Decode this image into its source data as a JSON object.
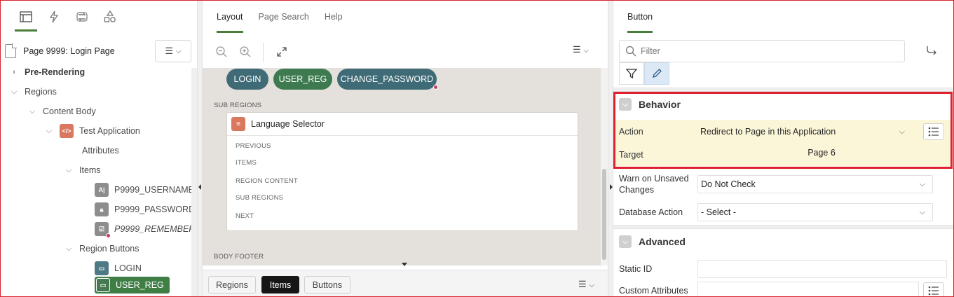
{
  "left_panel": {
    "tabs": [
      {
        "icon": "rendering-tree-icon",
        "active": true
      },
      {
        "icon": "dynamic-actions-icon",
        "active": false
      },
      {
        "icon": "processing-icon",
        "active": false
      },
      {
        "icon": "shared-components-icon",
        "active": false
      }
    ],
    "page_title": "Page 9999: Login Page",
    "tree": {
      "pre_rendering": "Pre-Rendering",
      "regions": "Regions",
      "content_body": "Content Body",
      "test_application": "Test Application",
      "attributes": "Attributes",
      "items": "Items",
      "item_username": "P9999_USERNAME",
      "item_password": "P9999_PASSWORD",
      "item_remember": "P9999_REMEMBER",
      "region_buttons": "Region Buttons",
      "btn_login": "LOGIN",
      "btn_user_reg": "USER_REG"
    }
  },
  "center_panel": {
    "tabs": [
      "Layout",
      "Page Search",
      "Help"
    ],
    "active_tab": "Layout",
    "canvas": {
      "buttons": [
        "LOGIN",
        "USER_REG",
        "CHANGE_PASSWORD"
      ],
      "sub_regions_label": "SUB REGIONS",
      "sub_region_title": "Language Selector",
      "slots": [
        "PREVIOUS",
        "ITEMS",
        "REGION CONTENT",
        "SUB REGIONS",
        "NEXT"
      ],
      "body_footer_label": "BODY FOOTER"
    },
    "bottom_tabs": [
      "Regions",
      "Items",
      "Buttons"
    ],
    "bottom_active": "Items"
  },
  "right_panel": {
    "tab": "Button",
    "filter_placeholder": "Filter",
    "behavior": {
      "title": "Behavior",
      "action_label": "Action",
      "action_value": "Redirect to Page in this Application",
      "target_label": "Target",
      "target_value": "Page 6",
      "warn_label": "Warn on Unsaved Changes",
      "warn_value": "Do Not Check",
      "db_action_label": "Database Action",
      "db_action_value": "- Select -"
    },
    "advanced": {
      "title": "Advanced",
      "static_id_label": "Static ID",
      "static_id_value": "",
      "custom_attr_label": "Custom Attributes",
      "custom_attr_value": ""
    }
  },
  "colors": {
    "accent_green": "#4b7d3a",
    "highlight_red": "#e0202e",
    "selected_row": "#fcf6d9",
    "teal_button": "#3f6b76",
    "green_button": "#3e7a50"
  }
}
